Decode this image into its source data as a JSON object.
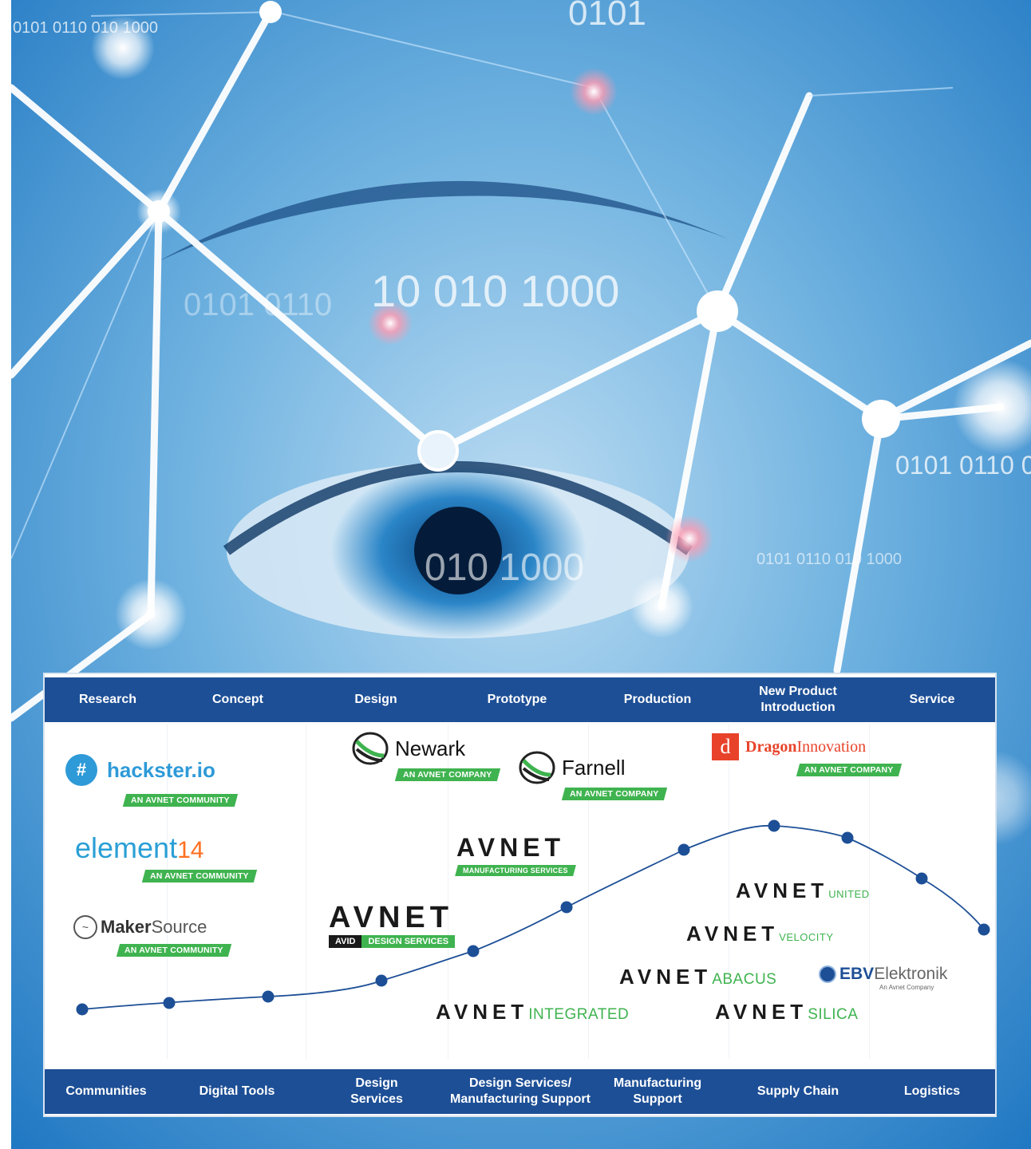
{
  "background": {
    "binary_texts": [
      "0101 0110 010  1000",
      "0101",
      "10 010 1000",
      "0101 0110",
      "0101 0110 0",
      "010 1000",
      "0101 0110 010 1000"
    ]
  },
  "top_stages": [
    "Research",
    "Concept",
    "Design",
    "Prototype",
    "Production",
    "New Product\nIntroduction",
    "Service"
  ],
  "bottom_stages": [
    "Communities",
    "Digital Tools",
    "Design\nServices",
    "Design Services/\nManufacturing Support",
    "Manufacturing\nSupport",
    "Supply Chain",
    "Logistics"
  ],
  "logos": {
    "hackster": {
      "name": "hackster.io",
      "tag": "AN AVNET COMMUNITY"
    },
    "element14": {
      "name_a": "element",
      "name_b": "14",
      "tag": "AN AVNET COMMUNITY"
    },
    "makersource": {
      "name_a": "Maker",
      "name_b": "Source",
      "tag": "AN AVNET COMMUNITY"
    },
    "newark": {
      "name": "Newark",
      "tag": "AN AVNET COMPANY"
    },
    "farnell": {
      "name": "Farnell",
      "tag": "AN AVNET COMPANY"
    },
    "dragon": {
      "name_a": "Dragon",
      "name_b": "Innovation",
      "tag": "AN AVNET COMPANY",
      "badge": "d"
    },
    "avnet_mfg": {
      "name": "AVNET",
      "sub": "MANUFACTURING SERVICES"
    },
    "avnet_avid": {
      "name": "AVNET",
      "sub_a": "AVID",
      "sub_b": "DESIGN SERVICES"
    },
    "avnet_integrated": {
      "name": "AVNET",
      "sub": "INTEGRATED"
    },
    "avnet_united": {
      "name": "AVNET",
      "sub": "UNITED"
    },
    "avnet_velocity": {
      "name": "AVNET",
      "sub": "VELOCITY"
    },
    "avnet_abacus": {
      "name": "AVNET",
      "sub": "ABACUS"
    },
    "avnet_silica": {
      "name": "AVNET",
      "sub": "SILICA"
    },
    "ebv": {
      "name_a": "EBV",
      "name_b": "Elektronik",
      "sub": "An Avnet Company"
    }
  },
  "colors": {
    "bar": "#1d4f96",
    "green": "#3fb34f",
    "curve": "#1d4f96",
    "dragon_red": "#e8432a"
  }
}
